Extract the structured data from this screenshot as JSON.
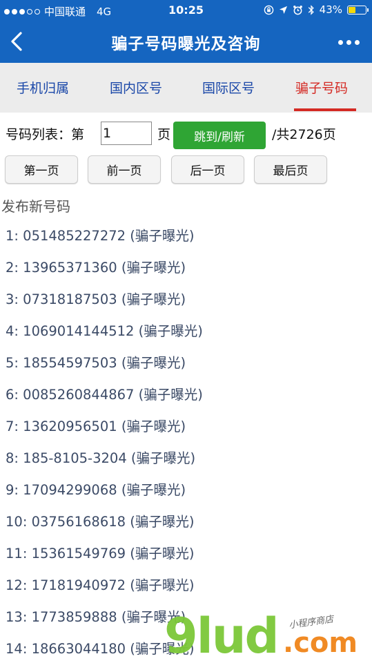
{
  "status_bar": {
    "carrier": "中国联通",
    "network": "4G",
    "time": "10:25",
    "battery_text": "43%",
    "battery_level": 0.43,
    "battery_color": "#f5d90a"
  },
  "nav": {
    "title": "骗子号码曝光及咨询",
    "bg_color": "#1565c0"
  },
  "tabs": [
    {
      "label": "手机归属",
      "active": false
    },
    {
      "label": "国内区号",
      "active": false
    },
    {
      "label": "国际区号",
      "active": false
    },
    {
      "label": "骗子号码",
      "active": true
    }
  ],
  "pager": {
    "list_label": "号码列表：第",
    "page_value": "1",
    "page_suffix": "页",
    "jump_label": "跳到/刷新",
    "total_label": "/共2726页",
    "first": "第一页",
    "prev": "前一页",
    "next": "后一页",
    "last": "最后页"
  },
  "section_title": "发布新号码",
  "items": [
    "1: 051485227272 (骗子曝光)",
    "2: 13965371360 (骗子曝光)",
    "3: 07318187503 (骗子曝光)",
    "4: 1069014144512 (骗子曝光)",
    "5: 18554597503 (骗子曝光)",
    "6: 0085260844867 (骗子曝光)",
    "7: 13620956501 (骗子曝光)",
    "8: 185-8105-3204 (骗子曝光)",
    "9: 17094299068 (骗子曝光)",
    "10: 03756168618 (骗子曝光)",
    "11: 15361549769 (骗子曝光)",
    "12: 17181940972 (骗子曝光)",
    "13: 1773859888 (骗子曝光)",
    "14: 18663044180 (骗子曝光)"
  ],
  "watermark": {
    "brand": "9lud",
    "tld": ".com",
    "tagline": "小程序商店"
  },
  "colors": {
    "tab_text": "#1a47a8",
    "tab_active": "#d42a24",
    "jump_button": "#2fa534",
    "list_text": "#3b4a66"
  }
}
